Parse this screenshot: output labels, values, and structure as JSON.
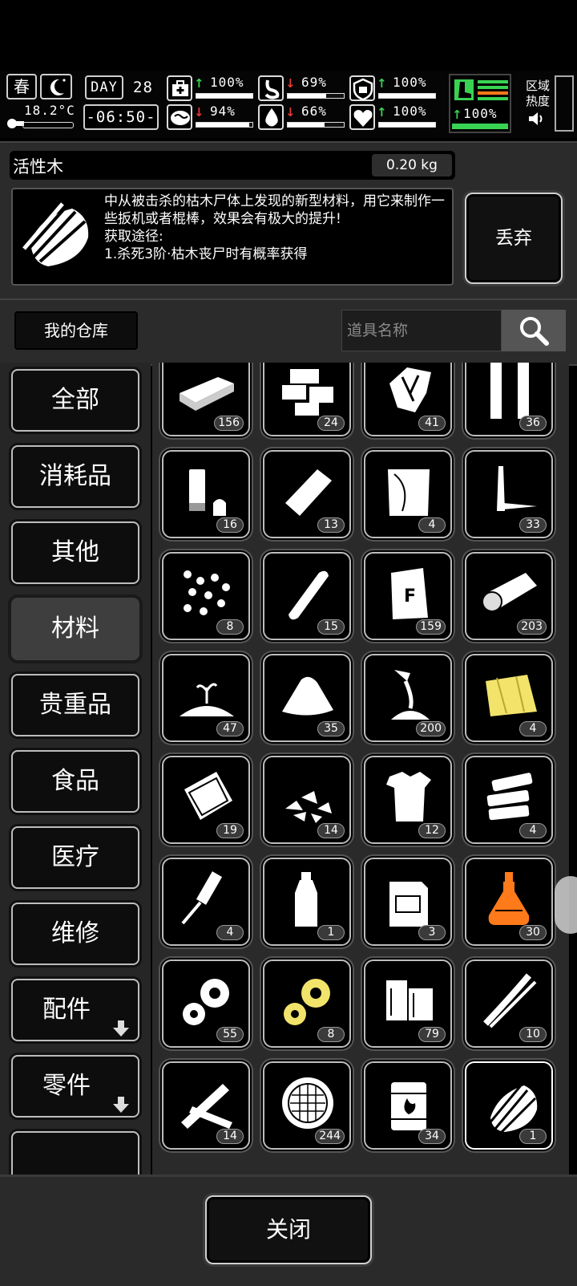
{
  "status": {
    "season": "春",
    "temperature": "18.2°C",
    "day_label": "DAY",
    "day": "28",
    "time": "-06:50-",
    "stats": [
      {
        "icon": "medkit-icon",
        "dir": "up",
        "value": "100%",
        "fill": 1.0
      },
      {
        "icon": "stomach-icon",
        "dir": "down",
        "value": "69%",
        "fill": 0.69
      },
      {
        "icon": "shield-icon",
        "dir": "up",
        "value": "100%",
        "fill": 1.0
      },
      {
        "icon": "brain-icon",
        "dir": "down",
        "value": "94%",
        "fill": 0.94
      },
      {
        "icon": "water-drop-icon",
        "dir": "down",
        "value": "66%",
        "fill": 0.66
      },
      {
        "icon": "heart-icon",
        "dir": "up",
        "value": "100%",
        "fill": 1.0
      }
    ],
    "stamina": {
      "value": "100%",
      "fill": 1.0,
      "color": "#39d353"
    },
    "zone_heat_label": "区域\n热度"
  },
  "item": {
    "name": "活性木",
    "weight": "0.20 kg",
    "description": "中从被击杀的枯木尸体上发现的新型材料，用它来制作一些扳机或者棍棒，效果会有极大的提升!\n获取途径:\n1.杀死3阶·枯木丧尸时有概率获得",
    "discard_label": "丢弃"
  },
  "warehouse": {
    "title": "我的仓库",
    "search_placeholder": "道具名称"
  },
  "categories": [
    {
      "label": "全部",
      "active": false,
      "arrow": false
    },
    {
      "label": "消耗品",
      "active": false,
      "arrow": false
    },
    {
      "label": "其他",
      "active": false,
      "arrow": false
    },
    {
      "label": "材料",
      "active": true,
      "arrow": false
    },
    {
      "label": "贵重品",
      "active": false,
      "arrow": false
    },
    {
      "label": "食品",
      "active": false,
      "arrow": false
    },
    {
      "label": "医疗",
      "active": false,
      "arrow": false
    },
    {
      "label": "维修",
      "active": false,
      "arrow": false
    },
    {
      "label": "配件",
      "active": false,
      "arrow": true
    },
    {
      "label": "零件",
      "active": false,
      "arrow": true
    }
  ],
  "items": [
    {
      "icon": "plank-icon",
      "count": "156"
    },
    {
      "icon": "bricks-icon",
      "count": "24"
    },
    {
      "icon": "scrap-metal-icon",
      "count": "41"
    },
    {
      "icon": "pipes-icon",
      "count": "36"
    },
    {
      "icon": "glue-tube-icon",
      "count": "16"
    },
    {
      "icon": "foil-icon",
      "count": "13"
    },
    {
      "icon": "cloth-icon",
      "count": "4"
    },
    {
      "icon": "nails-icon",
      "count": "33"
    },
    {
      "icon": "pellets-icon",
      "count": "8"
    },
    {
      "icon": "chalk-icon",
      "count": "15"
    },
    {
      "icon": "flour-bag-icon",
      "count": "159"
    },
    {
      "icon": "log-icon",
      "count": "203"
    },
    {
      "icon": "soil-sprout-icon",
      "count": "47"
    },
    {
      "icon": "sand-pile-icon",
      "count": "35"
    },
    {
      "icon": "pouring-powder-icon",
      "count": "200"
    },
    {
      "icon": "gold-cloth-icon",
      "count": "4"
    },
    {
      "icon": "leather-icon",
      "count": "19"
    },
    {
      "icon": "rubble-icon",
      "count": "14"
    },
    {
      "icon": "torn-shirt-icon",
      "count": "12"
    },
    {
      "icon": "stone-slabs-icon",
      "count": "4"
    },
    {
      "icon": "filter-rod-icon",
      "count": "4"
    },
    {
      "icon": "bottle-icon",
      "count": "1"
    },
    {
      "icon": "jerrycan-icon",
      "count": "3"
    },
    {
      "icon": "potion-flask-icon",
      "count": "30"
    },
    {
      "icon": "gears-icon",
      "count": "55"
    },
    {
      "icon": "gold-gears-icon",
      "count": "8"
    },
    {
      "icon": "wood-blocks-icon",
      "count": "79"
    },
    {
      "icon": "wires-icon",
      "count": "10"
    },
    {
      "icon": "broken-planks-icon",
      "count": "14"
    },
    {
      "icon": "mesh-icon",
      "count": "244"
    },
    {
      "icon": "burning-barrel-icon",
      "count": "34"
    },
    {
      "icon": "active-wood-icon",
      "count": "1",
      "selected": true
    }
  ],
  "close_label": "关闭",
  "colors": {
    "gold": "#f2e36b",
    "orange": "#ff7a1a",
    "green": "#39d353"
  }
}
